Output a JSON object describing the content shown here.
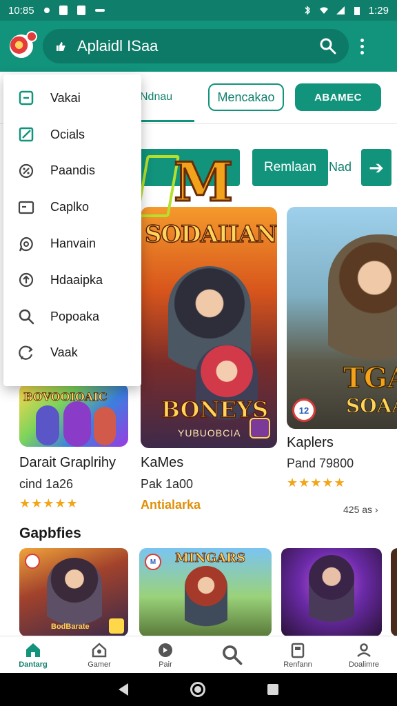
{
  "status_bar": {
    "time_left": "10:85",
    "time_right": "1:29"
  },
  "app_bar": {
    "title": "Aplaidl ISaa"
  },
  "tabs": {
    "tab1": "Ndnau",
    "tab2": "Mencakao",
    "tab3": "ABAMEC"
  },
  "actions": {
    "remlaan": "Remlaan",
    "nad": "Nad",
    "arrow": "➔"
  },
  "featured": {
    "logo_letter": "M",
    "center_card": {
      "title": "SODAIIAN",
      "bonus": "BONEYS",
      "subtitle": "YUBUOBCIA"
    },
    "right_card": {
      "badge": "12",
      "big_text": "TGA",
      "sub_text": "SOAAN"
    },
    "left_card": {
      "title": "BOVOOIOAIC"
    }
  },
  "cards_info": {
    "left": {
      "name": "Darait Graplrihy",
      "sub": "cind 1a26",
      "stars": "★★★★★"
    },
    "center": {
      "name": "KaMes",
      "sub": "Pak 1a00",
      "tag": "Antialarka"
    },
    "right": {
      "name": "Kaplers",
      "sub": "Pand 79800",
      "stars": "★★★★★"
    },
    "more": "425 as ›"
  },
  "section": {
    "title": "Gapbfies"
  },
  "thumbs": {
    "thumb1_caption": "BodBarate",
    "thumb2_title": "MINGARS",
    "thumb2_badge": "M"
  },
  "bottom_nav": [
    {
      "label": "Dantarg",
      "icon": "home-icon"
    },
    {
      "label": "Gamer",
      "icon": "games-icon"
    },
    {
      "label": "Pair",
      "icon": "pair-icon"
    },
    {
      "label": "",
      "icon": "search-icon"
    },
    {
      "label": "Renfann",
      "icon": "clipboard-icon"
    },
    {
      "label": "Doalimre",
      "icon": "profile-icon"
    }
  ],
  "menu": [
    {
      "label": "Vakai",
      "icon": "square-icon"
    },
    {
      "label": "Ocials",
      "icon": "edit-icon"
    },
    {
      "label": "Paandis",
      "icon": "percent-icon"
    },
    {
      "label": "Caplko",
      "icon": "card-icon"
    },
    {
      "label": "Hanvain",
      "icon": "chat-icon"
    },
    {
      "label": "Hdaaipka",
      "icon": "upload-icon"
    },
    {
      "label": "Popoaka",
      "icon": "search-icon"
    },
    {
      "label": "Vaak",
      "icon": "refresh-chat-icon"
    }
  ],
  "colors": {
    "primary": "#11937c",
    "primary_dark": "#0f7f6c",
    "star": "#f2a516"
  }
}
